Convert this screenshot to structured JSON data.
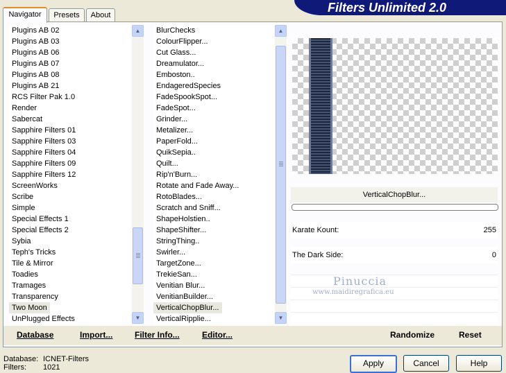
{
  "app_title": "Filters Unlimited 2.0",
  "tabs": [
    "Navigator",
    "Presets",
    "About"
  ],
  "categories": [
    "Plugins AB 02",
    "Plugins AB 03",
    "Plugins AB 06",
    "Plugins AB 07",
    "Plugins AB 08",
    "Plugins AB 21",
    "RCS Filter Pak 1.0",
    "Render",
    "Sabercat",
    "Sapphire Filters 01",
    "Sapphire Filters 03",
    "Sapphire Filters 04",
    "Sapphire Filters 09",
    "Sapphire Filters 12",
    "ScreenWorks",
    "Scribe",
    "Simple",
    "Special Effects 1",
    "Special Effects 2",
    "Sybia",
    "Teph's Tricks",
    "Tile & Mirror",
    "Toadies",
    "Tramages",
    "Transparency",
    "Two Moon",
    "UnPlugged Effects"
  ],
  "selected_category": "Two Moon",
  "filters": [
    "BlurChecks",
    "ColourFlipper...",
    "Cut Glass...",
    "Dreamulator...",
    "Emboston..",
    "EndageredSpecies",
    "FadeSpookSpot...",
    "FadeSpot...",
    "Grinder...",
    "Metalizer...",
    "PaperFold...",
    "QuikSepia..",
    "Quilt...",
    "Rip'n'Burn...",
    "Rotate and Fade Away...",
    "RotoBlades...",
    "Scratch and Sniff...",
    "ShapeHolstien..",
    "ShapeShifter...",
    "StringThing..",
    "Swirler...",
    "TargetZone...",
    "TrekieSan...",
    "Venitian Blur...",
    "VenitianBuilder...",
    "VerticalChopBlur...",
    "VerticalRipplie..."
  ],
  "selected_filter": "VerticalChopBlur...",
  "preview": {
    "filter_name": "VerticalChopBlur...",
    "params": [
      {
        "label": "Karate Kount:",
        "value": "255"
      },
      {
        "label": "The Dark Side:",
        "value": "0"
      }
    ],
    "watermark_line1": "Pinuccia",
    "watermark_line2": "www.maidiregrafica.eu"
  },
  "panel_buttons": {
    "database": "Database",
    "import": "Import...",
    "filter_info": "Filter Info...",
    "editor": "Editor...",
    "randomize": "Randomize",
    "reset": "Reset"
  },
  "status": {
    "database_label": "Database:",
    "database_value": "ICNET-Filters",
    "filters_label": "Filters:",
    "filters_value": "1021"
  },
  "dialog_buttons": {
    "apply": "Apply",
    "cancel": "Cancel",
    "help": "Help"
  },
  "colors": {
    "banner": "#0f1a78",
    "active_tab_accent": "#e68b2c",
    "selection": "#e9e8df"
  }
}
